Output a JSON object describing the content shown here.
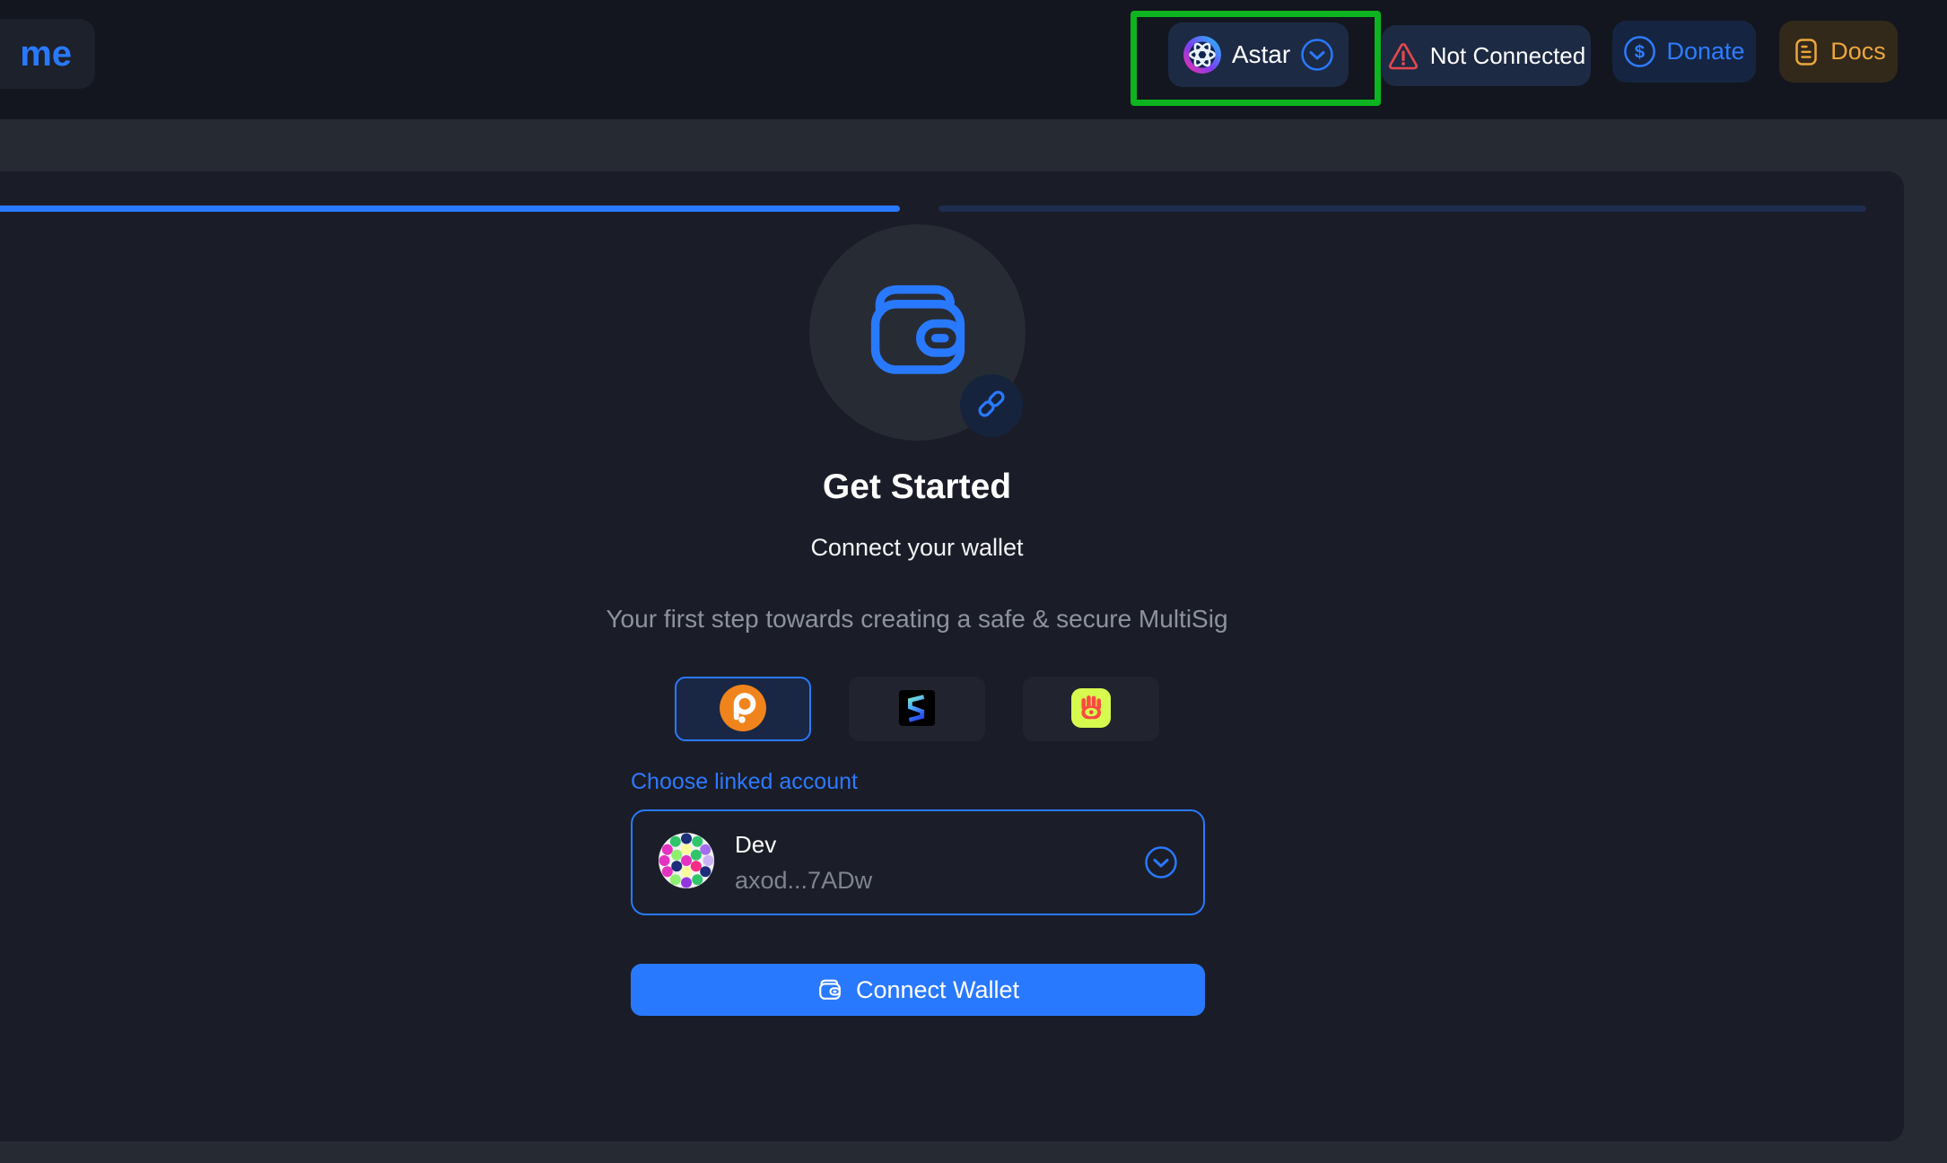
{
  "header": {
    "logo_text": "me",
    "network_button": {
      "label": "Astar",
      "icon": "astar-network-icon"
    },
    "connection_status": {
      "label": "Not Connected",
      "icon": "warning-triangle-icon"
    },
    "donate_button": {
      "label": "Donate",
      "icon": "dollar-circle-icon"
    },
    "docs_button": {
      "label": "Docs",
      "icon": "document-lines-icon"
    }
  },
  "annotation": {
    "type": "highlight-box",
    "target": "network-selector",
    "color": "#0db41f"
  },
  "progress": {
    "total_steps": 2,
    "active_step": 1
  },
  "main": {
    "hero_icon": "wallet-icon",
    "hero_badge_icon": "link-icon",
    "title": "Get Started",
    "subtitle": "Connect your wallet",
    "description": "Your first step towards creating a safe & secure MultiSig",
    "wallet_options": [
      {
        "id": "polkadot-js",
        "selected": true
      },
      {
        "id": "subwallet",
        "selected": false
      },
      {
        "id": "talisman",
        "selected": false
      }
    ],
    "account_section": {
      "label": "Choose linked account",
      "account": {
        "name": "Dev",
        "address": "axod...7ADw",
        "avatar": "polkadot-identicon"
      }
    },
    "connect_button": {
      "label": "Connect Wallet",
      "icon": "wallet-icon"
    }
  },
  "colors": {
    "accent_blue": "#2979ff",
    "annotation_green": "#0db41f",
    "warning_red": "#e5484d",
    "donate_blue": "#2e7dff",
    "docs_orange": "#eda73c",
    "polkadot_orange": "#f0841c",
    "talisman_lime": "#d7fa4f",
    "card_bg": "#1a1d27",
    "header_bg": "#13161e",
    "page_bg": "#262a33"
  }
}
